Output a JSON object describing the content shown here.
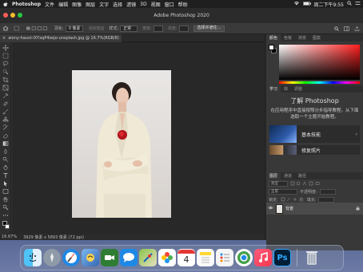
{
  "menubar": {
    "items": [
      "Photoshop",
      "文件",
      "编辑",
      "图像",
      "图层",
      "文字",
      "选择",
      "滤镜",
      "3D",
      "视图",
      "窗口",
      "帮助"
    ],
    "clock": "周二下午9:55"
  },
  "window": {
    "title": "Adobe Photoshop 2020"
  },
  "options": {
    "feather_label": "羽化:",
    "feather_value": "0 像素",
    "antialias_label": "消除锯齿",
    "style_label": "样式:",
    "style_value": "正常",
    "width_label": "宽度:",
    "height_label": "高度:",
    "select_mask_button": "选择并遮住..."
  },
  "document": {
    "tab_label": "aiony-haust-lXYxqP4zejo-unsplash.jpg @ 16.7%(RGB/8)",
    "tab_close": "×"
  },
  "status": {
    "zoom": "16.67%",
    "dimensions": "3929 像素 x 5893 像素 (72 ppi)"
  },
  "panels": {
    "color_tabs": [
      "颜色",
      "色板",
      "渐变",
      "图案"
    ],
    "learn_tabs": [
      "学习",
      "库",
      "调整"
    ],
    "learn_title": "了解 Photoshop",
    "learn_desc": "在应用程序中直接按照分步指导教程。从下面选取一个主题开始教程。",
    "cards": [
      {
        "label": "基本技能"
      },
      {
        "label": "修复照片"
      }
    ],
    "layers_tabs": [
      "图层",
      "通道",
      "路径"
    ],
    "search_kind": "类型",
    "blend_mode": "正常",
    "opacity_label": "不透明度:",
    "lock_label": "锁定:",
    "fill_label": "填充:",
    "layer_name": "背景"
  },
  "colors": {
    "accent_ps": "#31a8ff",
    "ps_icon_bg": "#001e36"
  },
  "dock": {
    "apps": [
      "finder-icon",
      "launchpad-icon",
      "safari-icon",
      "photos-icon",
      "facetime-icon",
      "messages-icon",
      "maps-icon",
      "photos-app-icon",
      "calendar-icon",
      "notes-icon",
      "reminders-icon",
      "browser-icon",
      "music-icon",
      "photoshop-icon",
      "trash-icon"
    ],
    "calendar_day": "4",
    "ps_label": "Ps"
  }
}
